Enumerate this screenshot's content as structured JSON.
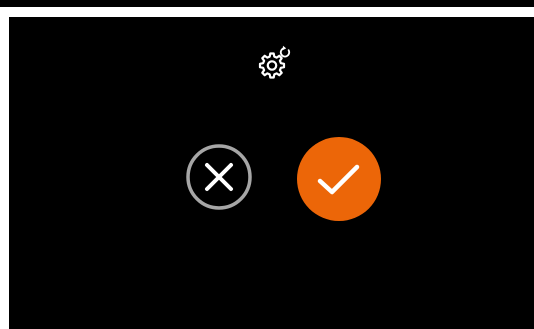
{
  "dialog": {
    "top_icon": "settings-reset-icon",
    "cancel": {
      "icon": "close-icon",
      "label": "",
      "border_color": "#a6a6a6",
      "icon_color": "#ffffff"
    },
    "confirm": {
      "icon": "check-icon",
      "label": "",
      "background_color": "#ec6608",
      "icon_color": "#ffffff"
    }
  },
  "colors": {
    "screen_background": "#000000",
    "top_bar": "#000000",
    "outer_frame": "#ffffff",
    "accent": "#ec6608",
    "icon": "#ffffff"
  }
}
